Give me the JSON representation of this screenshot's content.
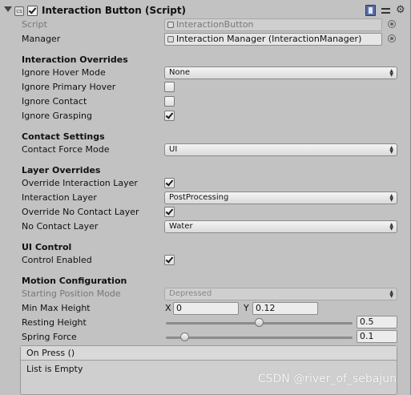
{
  "component": {
    "title": "Interaction Button (Script)",
    "enabled": true,
    "header_icons": [
      "help-book-icon",
      "preset-sliders-icon",
      "gear-icon"
    ]
  },
  "script_row": {
    "label": "Script",
    "value": "InteractionButton"
  },
  "manager_row": {
    "label": "Manager",
    "value": "Interaction Manager (InteractionManager)"
  },
  "sections": {
    "interaction_overrides": "Interaction Overrides",
    "contact_settings": "Contact Settings",
    "layer_overrides": "Layer Overrides",
    "ui_control": "UI Control",
    "motion_configuration": "Motion Configuration"
  },
  "fields": {
    "ignore_hover_mode": {
      "label": "Ignore Hover Mode",
      "value": "None"
    },
    "ignore_primary_hover": {
      "label": "Ignore Primary Hover",
      "checked": false
    },
    "ignore_contact": {
      "label": "Ignore Contact",
      "checked": false
    },
    "ignore_grasping": {
      "label": "Ignore Grasping",
      "checked": true
    },
    "contact_force_mode": {
      "label": "Contact Force Mode",
      "value": "UI"
    },
    "override_interaction_layer": {
      "label": "Override Interaction Layer",
      "checked": true
    },
    "interaction_layer": {
      "label": "Interaction Layer",
      "value": "PostProcessing"
    },
    "override_no_contact_layer": {
      "label": "Override No Contact Layer",
      "checked": true
    },
    "no_contact_layer": {
      "label": "No Contact Layer",
      "value": "Water"
    },
    "control_enabled": {
      "label": "Control Enabled",
      "checked": true
    },
    "starting_position_mode": {
      "label": "Starting Position Mode",
      "value": "Depressed"
    },
    "min_max_height": {
      "label": "Min Max Height",
      "x_label": "X",
      "x": "0",
      "y_label": "Y",
      "y": "0.12"
    },
    "resting_height": {
      "label": "Resting Height",
      "value": "0.5",
      "slider_fraction": 0.5
    },
    "spring_force": {
      "label": "Spring Force",
      "value": "0.1",
      "slider_fraction": 0.1
    }
  },
  "event": {
    "title": "On Press ()",
    "body": "List is Empty"
  },
  "watermark": "CSDN @river_of_sebajun"
}
